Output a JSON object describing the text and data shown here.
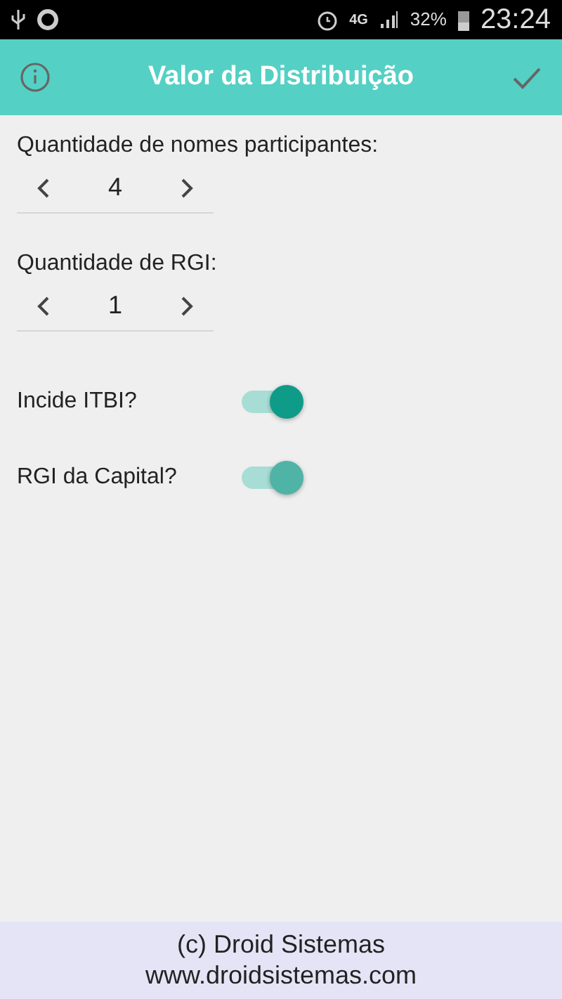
{
  "status_bar": {
    "network": "4G",
    "battery": "32%",
    "time": "23:24"
  },
  "toolbar": {
    "title": "Valor da Distribuição"
  },
  "steppers": [
    {
      "label": "Quantidade de nomes participantes:",
      "value": "4"
    },
    {
      "label": "Quantidade de RGI:",
      "value": "1"
    }
  ],
  "toggles": [
    {
      "label": "Incide ITBI?",
      "on": true,
      "disabled": false
    },
    {
      "label": "RGI da Capital?",
      "on": true,
      "disabled": true
    }
  ],
  "footer": {
    "line_1": "(c) Droid Sistemas",
    "line_2": "www.droidsistemas.com"
  }
}
